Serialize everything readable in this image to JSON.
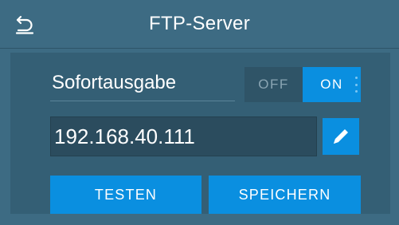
{
  "header": {
    "title": "FTP-Server",
    "back_icon": "back-arrow-icon"
  },
  "settings": {
    "immediate_output_label": "Sofortausgabe",
    "toggle": {
      "off_label": "OFF",
      "on_label": "ON",
      "selected": "ON"
    },
    "ip_address": "192.168.40.111",
    "edit_icon": "pencil-icon"
  },
  "actions": {
    "test_label": "TESTEN",
    "save_label": "SPEICHERN"
  },
  "colors": {
    "background": "#3d6b83",
    "panel": "#345f75",
    "accent": "#0a8fe0",
    "field": "#2b4c5e"
  }
}
